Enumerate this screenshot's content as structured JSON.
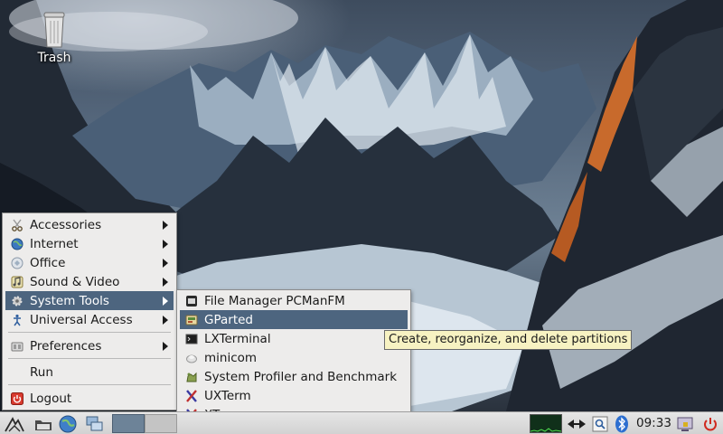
{
  "desktop": {
    "trash_label": "Trash"
  },
  "main_menu": {
    "items": [
      {
        "label": "Accessories",
        "icon": "scissors-icon",
        "submenu": true
      },
      {
        "label": "Internet",
        "icon": "globe-icon",
        "submenu": true
      },
      {
        "label": "Office",
        "icon": "office-icon",
        "submenu": true
      },
      {
        "label": "Sound & Video",
        "icon": "music-note-icon",
        "submenu": true
      },
      {
        "label": "System Tools",
        "icon": "gear-icon",
        "submenu": true,
        "highlighted": true
      },
      {
        "label": "Universal Access",
        "icon": "accessibility-icon",
        "submenu": true
      },
      {
        "label": "Preferences",
        "icon": "preferences-icon",
        "submenu": true
      },
      {
        "label": "Run",
        "icon": "",
        "submenu": false
      },
      {
        "label": "Logout",
        "icon": "logout-icon",
        "submenu": false
      }
    ]
  },
  "system_tools_menu": {
    "items": [
      {
        "label": "File Manager PCManFM",
        "icon": "file-manager-icon"
      },
      {
        "label": "GParted",
        "icon": "gparted-icon",
        "highlighted": true
      },
      {
        "label": "LXTerminal",
        "icon": "terminal-icon"
      },
      {
        "label": "minicom",
        "icon": "minicom-icon"
      },
      {
        "label": "System Profiler and Benchmark",
        "icon": "profiler-icon"
      },
      {
        "label": "UXTerm",
        "icon": "xterm-icon"
      },
      {
        "label": "XTerm",
        "icon": "xterm-icon"
      }
    ]
  },
  "tooltip": {
    "text": "Create, reorganize, and delete partitions"
  },
  "taskbar": {
    "clock": "09:33"
  },
  "colors": {
    "menu_bg": "#edeceb",
    "highlight": "#4d657f",
    "tooltip_bg": "#f7f2c2",
    "taskbar": "#d8d8d8"
  }
}
